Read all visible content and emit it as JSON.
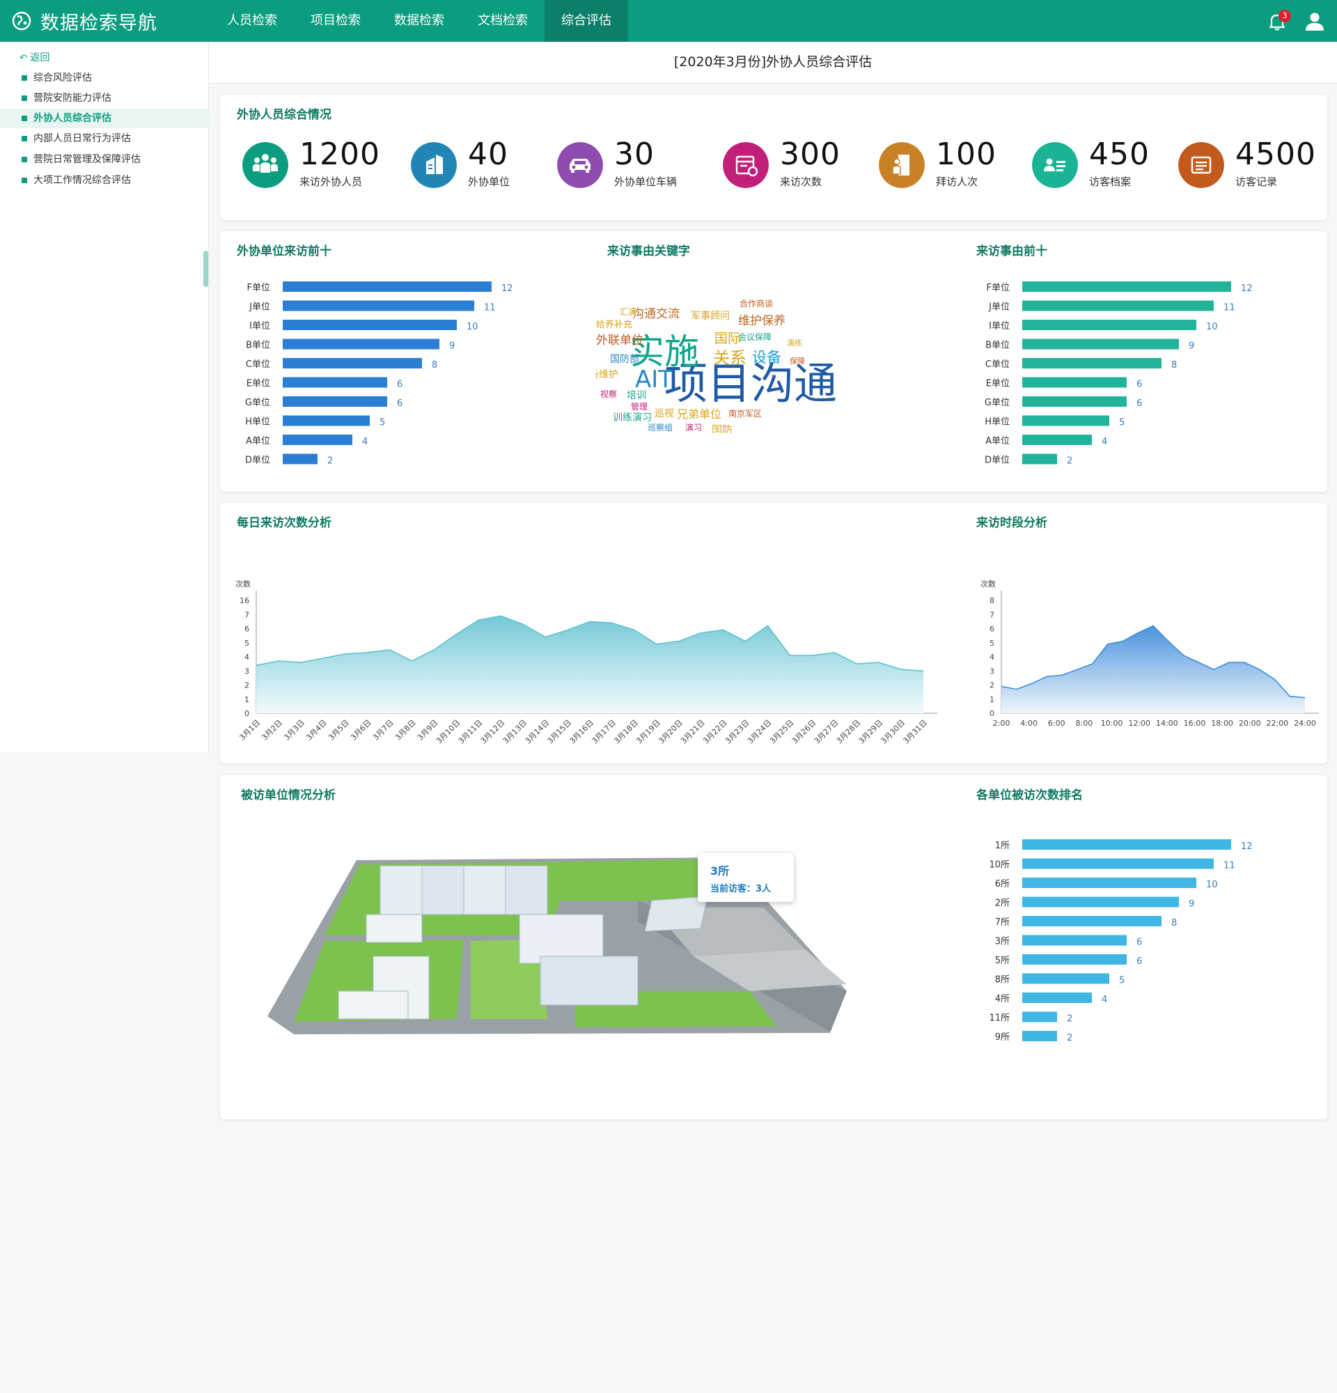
{
  "app": {
    "title": "数据检索导航"
  },
  "nav": {
    "tabs": [
      {
        "label": "人员检索"
      },
      {
        "label": "项目检索"
      },
      {
        "label": "数据检索"
      },
      {
        "label": "文档检索"
      },
      {
        "label": "综合评估"
      }
    ]
  },
  "header": {
    "notification_count": "3"
  },
  "sidebar": {
    "back_label": "返回",
    "items": [
      {
        "label": "综合风险评估"
      },
      {
        "label": "营院安防能力评估"
      },
      {
        "label": "外协人员综合评估"
      },
      {
        "label": "内部人员日常行为评估"
      },
      {
        "label": "营院日常管理及保障评估"
      },
      {
        "label": "大项工作情况综合评估"
      }
    ]
  },
  "page": {
    "title": "[2020年3月份]外协人员综合评估"
  },
  "summary": {
    "title": "外协人员综合情况",
    "stats": [
      {
        "value": "1200",
        "label": "来访外协人员",
        "icon": "people-group-icon",
        "color": "#0b9d80"
      },
      {
        "value": "40",
        "label": "外协单位",
        "icon": "building-icon",
        "color": "#2186b5"
      },
      {
        "value": "30",
        "label": "外协单位车辆",
        "icon": "car-icon",
        "color": "#8e4cb0"
      },
      {
        "value": "300",
        "label": "来访次数",
        "icon": "calendar-clock-icon",
        "color": "#c21f79"
      },
      {
        "value": "100",
        "label": "拜访人次",
        "icon": "door-person-icon",
        "color": "#c98126"
      },
      {
        "value": "450",
        "label": "访客档案",
        "icon": "id-card-icon",
        "color": "#1ab396"
      },
      {
        "value": "4500",
        "label": "访客记录",
        "icon": "file-list-icon",
        "color": "#c25a1e"
      }
    ]
  },
  "panels": {
    "top_units": {
      "title": "外协单位来访前十"
    },
    "keywords": {
      "title": "来访事由关键字",
      "words": [
        {
          "text": "项目沟通",
          "color": "#1f5aa7"
        },
        {
          "text": "实施",
          "color": "#10a58a"
        },
        {
          "text": "AIT",
          "color": "#2b87c8"
        },
        {
          "text": "关系",
          "color": "#d7a51c"
        },
        {
          "text": "设备",
          "color": "#1aa2d8"
        },
        {
          "text": "国际",
          "color": "#d7a51c"
        },
        {
          "text": "沟通交流",
          "color": "#b86622"
        },
        {
          "text": "维护保养",
          "color": "#b86622"
        },
        {
          "text": "外联单位",
          "color": "#c25a1e"
        },
        {
          "text": "给养补充",
          "color": "#d7a51c"
        },
        {
          "text": "汇演",
          "color": "#d7a51c"
        },
        {
          "text": "军事顾问",
          "color": "#d7a51c"
        },
        {
          "text": "合作商谈",
          "color": "#c25a1e"
        },
        {
          "text": "会议保障",
          "color": "#10a58a"
        },
        {
          "text": "演练",
          "color": "#d7a51c"
        },
        {
          "text": "保障",
          "color": "#c25a1e"
        },
        {
          "text": "国防部",
          "color": "#2b87c8"
        },
        {
          "text": "设备维护",
          "color": "#d7a51c"
        },
        {
          "text": "视察",
          "color": "#c21f79"
        },
        {
          "text": "培训",
          "color": "#10a58a"
        },
        {
          "text": "管理",
          "color": "#c21f79"
        },
        {
          "text": "巡视",
          "color": "#d7a51c"
        },
        {
          "text": "兄弟单位",
          "color": "#d7a51c"
        },
        {
          "text": "南京军区",
          "color": "#c25a1e"
        },
        {
          "text": "训练演习",
          "color": "#10a58a"
        },
        {
          "text": "巡察组",
          "color": "#2b87c8"
        },
        {
          "text": "演习",
          "color": "#c21f79"
        },
        {
          "text": "国防",
          "color": "#d7a51c"
        }
      ]
    },
    "top_reasons": {
      "title": "来访事由前十"
    },
    "daily": {
      "title": "每日来访次数分析"
    },
    "hourly": {
      "title": "来访时段分析"
    },
    "campus": {
      "title": "被访单位情况分析",
      "tooltip_title": "3所",
      "tooltip_line": "当前访客：3人"
    },
    "ranking": {
      "title": "各单位被访次数排名"
    }
  },
  "chart_data": [
    {
      "type": "bar",
      "title": "外协单位来访前十",
      "categories": [
        "F单位",
        "J单位",
        "I单位",
        "B单位",
        "C单位",
        "E单位",
        "G单位",
        "H单位",
        "A单位",
        "D单位"
      ],
      "values": [
        12,
        11,
        10,
        9,
        8,
        6,
        6,
        5,
        4,
        2
      ],
      "color": "#2a7fd4",
      "orientation": "horizontal"
    },
    {
      "type": "bar",
      "title": "来访事由前十",
      "categories": [
        "F单位",
        "J单位",
        "I单位",
        "B单位",
        "C单位",
        "E单位",
        "G单位",
        "H单位",
        "A单位",
        "D单位"
      ],
      "values": [
        12,
        11,
        10,
        9,
        8,
        6,
        6,
        5,
        4,
        2
      ],
      "color": "#22b49a",
      "orientation": "horizontal"
    },
    {
      "type": "area",
      "title": "每日来访次数分析",
      "ylabel": "次数",
      "yticks": [
        "0",
        "1",
        "2",
        "3",
        "4",
        "5",
        "6",
        "7",
        "16"
      ],
      "ylim": [
        0,
        8
      ],
      "categories": [
        "3月1日",
        "3月2日",
        "3月3日",
        "3月4日",
        "3月5日",
        "3月6日",
        "3月7日",
        "3月8日",
        "3月9日",
        "3月10日",
        "3月11日",
        "3月12日",
        "3月13日",
        "3月14日",
        "3月15日",
        "3月16日",
        "3月17日",
        "3月18日",
        "3月19日",
        "3月20日",
        "3月21日",
        "3月22日",
        "3月23日",
        "3月24日",
        "3月25日",
        "3月26日",
        "3月27日",
        "3月28日",
        "3月29日",
        "3月30日",
        "3月31日"
      ],
      "values": [
        3.4,
        3.7,
        3.6,
        3.9,
        4.2,
        4.3,
        4.5,
        3.7,
        4.5,
        5.6,
        6.6,
        6.9,
        6.3,
        5.4,
        5.9,
        6.5,
        6.4,
        5.9,
        4.9,
        5.1,
        5.7,
        5.9,
        5.1,
        6.2,
        4.1,
        4.1,
        4.3,
        3.5,
        3.6,
        3.1,
        3.0
      ],
      "color": "#5bc3d2"
    },
    {
      "type": "area",
      "title": "来访时段分析",
      "ylabel": "次数",
      "yticks": [
        "0",
        "1",
        "2",
        "3",
        "4",
        "5",
        "6",
        "7",
        "8"
      ],
      "ylim": [
        0,
        8
      ],
      "categories": [
        "2:00",
        "4:00",
        "6:00",
        "8:00",
        "10:00",
        "12:00",
        "14:00",
        "16:00",
        "18:00",
        "20:00",
        "22:00",
        "24:00"
      ],
      "values": [
        1.9,
        1.7,
        2.1,
        2.6,
        2.7,
        3.1,
        3.5,
        4.9,
        5.1,
        5.7,
        6.2,
        5.1,
        4.1,
        3.6,
        3.1,
        3.6,
        3.6,
        3.1,
        2.4,
        1.2,
        1.1
      ],
      "color": "#3d8fd8"
    },
    {
      "type": "bar",
      "title": "各单位被访次数排名",
      "categories": [
        "1所",
        "10所",
        "6所",
        "2所",
        "7所",
        "3所",
        "5所",
        "8所",
        "4所",
        "11所",
        "9所"
      ],
      "values": [
        12,
        11,
        10,
        9,
        8,
        6,
        6,
        5,
        4,
        2,
        2
      ],
      "color": "#3fb6e3",
      "orientation": "horizontal"
    }
  ]
}
